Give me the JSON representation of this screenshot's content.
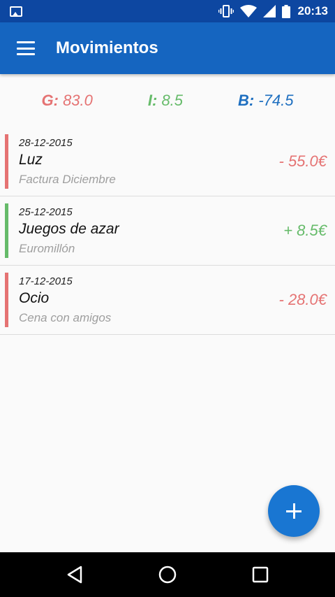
{
  "status_bar": {
    "time": "20:13",
    "icons": [
      "gallery-icon",
      "vibrate-icon",
      "wifi-icon",
      "signal-icon",
      "battery-icon"
    ]
  },
  "app_bar": {
    "title": "Movimientos",
    "menu_icon": "menu-icon"
  },
  "summary": {
    "g_label": "G:",
    "g_value": "83.0",
    "i_label": "I:",
    "i_value": "8.5",
    "b_label": "B:",
    "b_value": "-74.5"
  },
  "movements": [
    {
      "date": "28-12-2015",
      "title": "Luz",
      "description": "Factura Diciembre",
      "amount": "- 55.0€",
      "type": "expense",
      "color": "#e57373"
    },
    {
      "date": "25-12-2015",
      "title": "Juegos de azar",
      "description": "Euromillón",
      "amount": "+ 8.5€",
      "type": "income",
      "color": "#66bb6a"
    },
    {
      "date": "17-12-2015",
      "title": "Ocio",
      "description": "Cena con amigos",
      "amount": "- 28.0€",
      "type": "expense",
      "color": "#e57373"
    }
  ],
  "fab": {
    "icon": "plus-icon"
  },
  "nav_bar": {
    "icons": [
      "back-icon",
      "home-icon",
      "recents-icon"
    ]
  },
  "colors": {
    "status_bar": "#0d47a1",
    "app_bar": "#1565c0",
    "expense": "#e57373",
    "income": "#66bb6a",
    "balance": "#1e6fc0",
    "fab": "#1976d2"
  }
}
